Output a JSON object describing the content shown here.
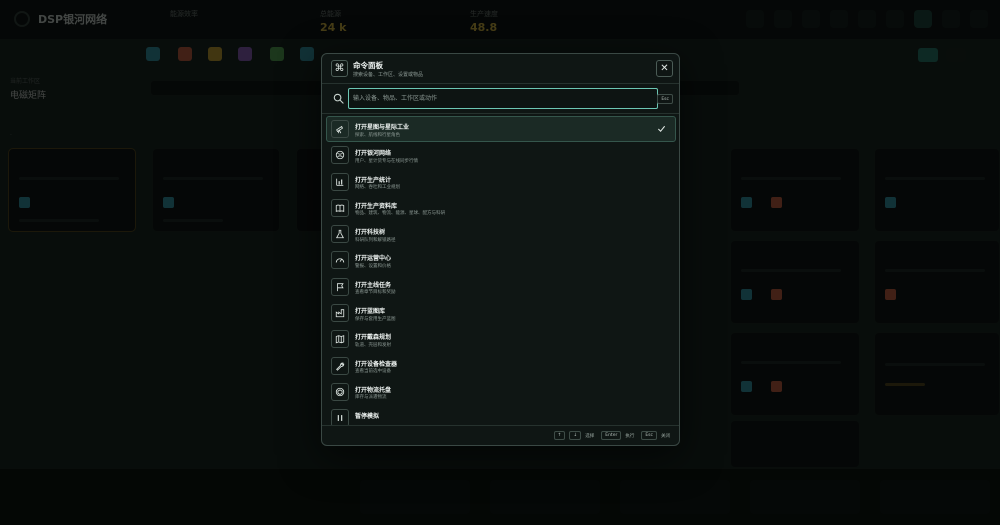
{
  "palette": {
    "title": "命令面板",
    "subtitle": "搜索设备、工作区、设置或物品",
    "close_glyph": "✕",
    "logo_glyph": "⌘",
    "search": {
      "placeholder": "输入设备、物品、工作区或动作",
      "value": "",
      "esc_label": "Esc"
    },
    "items": [
      {
        "title": "打开星图与星际工业",
        "subtitle": "探索、航线和行星角色",
        "icon": "telescope-icon",
        "selected": true
      },
      {
        "title": "打开银河网络",
        "subtitle": "用户、星计货专与在线同步行情",
        "icon": "globe-icon",
        "selected": false
      },
      {
        "title": "打开生产统计",
        "subtitle": "网络、吞吐和工业规划",
        "icon": "bar-chart-icon",
        "selected": false
      },
      {
        "title": "打开生产资料库",
        "subtitle": "物品、建筑、物流、能源、星球、配方与科研",
        "icon": "book-icon",
        "selected": false
      },
      {
        "title": "打开科技树",
        "subtitle": "科研队列和解锁路径",
        "icon": "flask-icon",
        "selected": false
      },
      {
        "title": "打开运营中心",
        "subtitle": "警报、设置和价格",
        "icon": "gauge-icon",
        "selected": false
      },
      {
        "title": "打开主线任务",
        "subtitle": "查看章节目标和奖励",
        "icon": "flag-icon",
        "selected": false
      },
      {
        "title": "打开蓝图库",
        "subtitle": "保存与套用生产蓝图",
        "icon": "factory-icon",
        "selected": false
      },
      {
        "title": "打开戴森规划",
        "subtitle": "轨道、壳层和发射",
        "icon": "map-icon",
        "selected": false
      },
      {
        "title": "打开设备检查器",
        "subtitle": "查看当前选中设备",
        "icon": "wrench-icon",
        "selected": false
      },
      {
        "title": "打开物流托盘",
        "subtitle": "库存与派遣物流",
        "icon": "package-icon",
        "selected": false
      },
      {
        "title": "暂停模拟",
        "subtitle": "",
        "icon": "pause-icon",
        "selected": false
      }
    ],
    "footer": {
      "nav_keys": [
        "↑",
        "↓"
      ],
      "nav_label": "选择",
      "enter_key": "Enter",
      "enter_label": "执行",
      "esc_key": "Esc",
      "esc_label": "关闭"
    }
  },
  "background": {
    "app_title": "DSP银河网络",
    "workspace_label": "当前工作区",
    "stats": [
      {
        "label": "能源效率",
        "value": ""
      },
      {
        "label": "总能源",
        "value": "24 k"
      },
      {
        "label": "生产速度",
        "value": "48.8"
      }
    ],
    "page_title": "电磁矩阵"
  },
  "colors": {
    "accent": "#6cc6b3",
    "selection": "#1b2a25",
    "panel": "#0f1614",
    "warning": "#e8c94a"
  }
}
